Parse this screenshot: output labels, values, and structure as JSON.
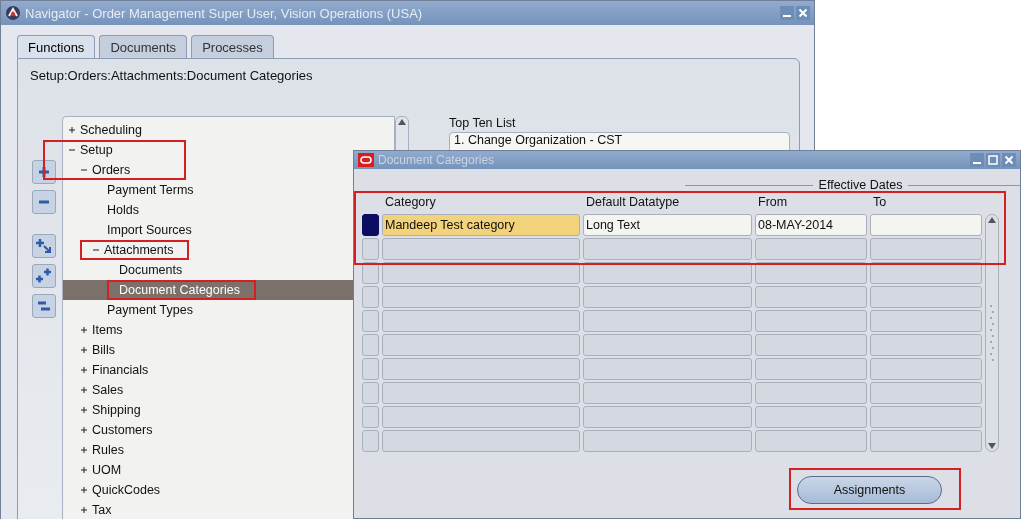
{
  "navigator": {
    "title": "Navigator - Order Management Super User, Vision Operations (USA)",
    "tabs": [
      {
        "label": "Functions",
        "selected": true
      },
      {
        "label": "Documents",
        "selected": false
      },
      {
        "label": "Processes",
        "selected": false
      }
    ],
    "breadcrumb": "Setup:Orders:Attachments:Document Categories",
    "tree": [
      {
        "label": "Scheduling",
        "expanded": false,
        "selected": false,
        "highlighted": false
      },
      {
        "label": "Setup",
        "expanded": true,
        "selected": false,
        "highlighted": true,
        "children": [
          {
            "label": "Orders",
            "expanded": true,
            "selected": false,
            "highlighted": true,
            "children": [
              {
                "label": "Payment Terms",
                "selected": false,
                "highlighted": false
              },
              {
                "label": "Holds",
                "selected": false,
                "highlighted": false
              },
              {
                "label": "Import Sources",
                "selected": false,
                "highlighted": false
              },
              {
                "label": "Attachments",
                "expanded": true,
                "selected": false,
                "highlighted": true,
                "children": [
                  {
                    "label": "Documents",
                    "selected": false,
                    "highlighted": false
                  },
                  {
                    "label": "Document Categories",
                    "selected": true,
                    "highlighted": true
                  }
                ]
              },
              {
                "label": "Payment Types",
                "selected": false,
                "highlighted": false
              }
            ]
          },
          {
            "label": "Items",
            "expanded": false,
            "selected": false,
            "highlighted": false
          },
          {
            "label": "Bills",
            "expanded": false,
            "selected": false,
            "highlighted": false
          },
          {
            "label": "Financials",
            "expanded": false,
            "selected": false,
            "highlighted": false
          },
          {
            "label": "Sales",
            "expanded": false,
            "selected": false,
            "highlighted": false
          },
          {
            "label": "Shipping",
            "expanded": false,
            "selected": false,
            "highlighted": false
          },
          {
            "label": "Customers",
            "expanded": false,
            "selected": false,
            "highlighted": false
          },
          {
            "label": "Rules",
            "expanded": false,
            "selected": false,
            "highlighted": false
          },
          {
            "label": "UOM",
            "expanded": false,
            "selected": false,
            "highlighted": false
          },
          {
            "label": "QuickCodes",
            "expanded": false,
            "selected": false,
            "highlighted": false
          },
          {
            "label": "Tax",
            "expanded": false,
            "selected": false,
            "highlighted": false
          }
        ]
      }
    ],
    "top_ten": {
      "label": "Top Ten List",
      "items": [
        "1. Change Organization - CST"
      ]
    }
  },
  "document_categories": {
    "title": "Document Categories",
    "group_label": "Effective Dates",
    "highlighted": true,
    "columns": [
      "Category",
      "Default Datatype",
      "From",
      "To"
    ],
    "rows": [
      {
        "selected": true,
        "cells": [
          "Mandeep Test category",
          "Long Text",
          "08-MAY-2014"
        ]
      },
      {
        "selected": false
      },
      {
        "selected": false
      },
      {
        "selected": false
      },
      {
        "selected": false
      },
      {
        "selected": false
      },
      {
        "selected": false
      },
      {
        "selected": false
      },
      {
        "selected": false
      },
      {
        "selected": false
      }
    ],
    "button": {
      "label": "Assignments",
      "highlighted": true
    }
  }
}
